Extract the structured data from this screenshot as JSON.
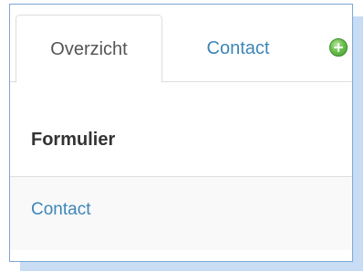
{
  "tabs": [
    {
      "label": "Overzicht",
      "active": true
    },
    {
      "label": "Contact",
      "active": false
    }
  ],
  "add_button": {
    "icon": "add-circle-icon",
    "color": "#5cb944"
  },
  "table": {
    "column_header": "Formulier",
    "rows": [
      {
        "formulier": "Contact"
      }
    ]
  },
  "colors": {
    "link": "#3d86b8",
    "panel_border": "#7da6d6",
    "shadow": "#c8dcf3"
  }
}
